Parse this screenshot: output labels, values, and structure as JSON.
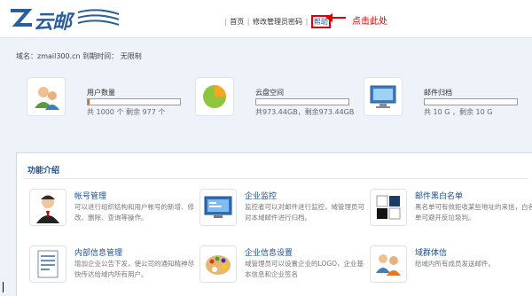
{
  "header": {
    "logo_text": "云邮",
    "nav": {
      "home": "首页",
      "change_password": "修改管理员密码",
      "help": "帮助"
    },
    "callout": "点击此处"
  },
  "account": {
    "domain_line": "域名：zmail300.cn 到期时间： 无限制"
  },
  "quotas": [
    {
      "label": "用户数量",
      "text": "共 1000 个 剩余 977 个",
      "used_fraction": 0.023,
      "icon": "users-icon"
    },
    {
      "label": "云盘空间",
      "text": "共973.44GB，剩余973.44GB",
      "used_fraction": 0.0,
      "icon": "pie-chart-icon"
    },
    {
      "label": "邮件归档",
      "text": "共 10 G ，剩余 10 G",
      "used_fraction": 0.0,
      "icon": "monitor-icon"
    }
  ],
  "features": {
    "title": "功能介绍",
    "items": [
      {
        "title": "帐号管理",
        "desc": "可以进行组织结构和用户帐号的新增、修改、删除、查询等操作。",
        "icon": "account-icon"
      },
      {
        "title": "企业监控",
        "desc": "监控者可以对邮件进行监控，域管理员可对本域邮件进行归档。",
        "icon": "monitor-screen-icon"
      },
      {
        "title": "邮件黑白名单",
        "desc": "黑名单可有效拒收某些地址的来信，白名单可避开反垃圾判。",
        "icon": "blackwhite-icon"
      },
      {
        "title": "内部信息管理",
        "desc": "增加企业公告下发，使公司的通知精神尽快传达给域内所有用户。",
        "icon": "document-icon"
      },
      {
        "title": "企业信息设置",
        "desc": "域管理员可以设置企业的LOGO，企业基本信息和企业签名",
        "icon": "palette-icon"
      },
      {
        "title": "域群体信",
        "desc": "给域内所有成员发送邮件。",
        "icon": "group-mail-icon"
      }
    ]
  }
}
